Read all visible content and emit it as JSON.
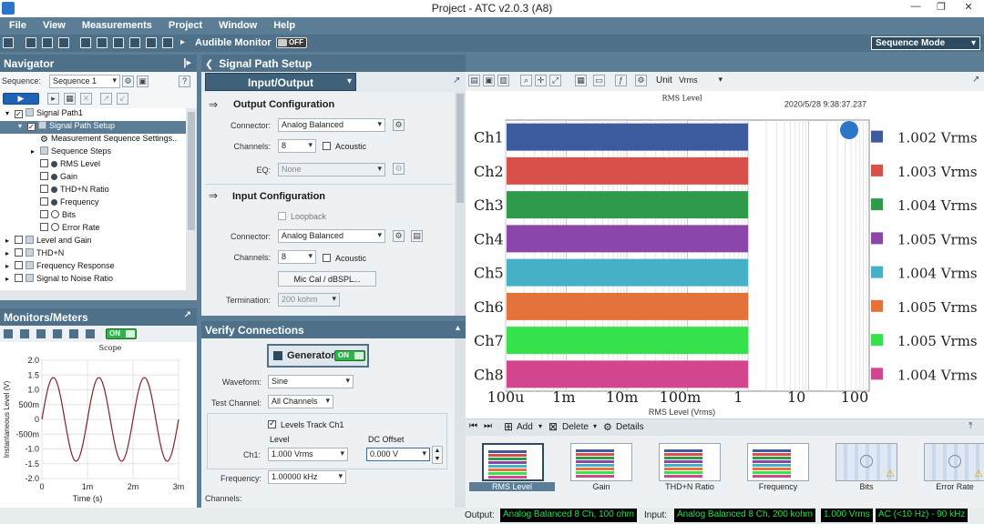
{
  "window": {
    "title": "Project - ATC v2.0.3 (A8)",
    "minimize": "—",
    "restore": "❐",
    "close": "✕"
  },
  "menu": [
    "File",
    "View",
    "Measurements",
    "Project",
    "Window",
    "Help"
  ],
  "toolbar": {
    "audible_monitor_label": "Audible Monitor",
    "audible_monitor_state": "OFF",
    "mode_select": "Sequence Mode"
  },
  "navigator": {
    "title": "Navigator",
    "sequence_label": "Sequence:",
    "sequence_value": "Sequence 1",
    "tree": [
      {
        "label": "Signal Path1",
        "level": 0,
        "icon": "folder-icon",
        "checked": true,
        "expander": "▾"
      },
      {
        "label": "Signal Path Setup",
        "level": 1,
        "icon": "folder-icon",
        "checked": true,
        "expander": "▾",
        "selected": true
      },
      {
        "label": "Measurement Sequence Settings..",
        "level": 2,
        "icon": "gear-icon",
        "checked": null,
        "expander": ""
      },
      {
        "label": "Sequence Steps",
        "level": 2,
        "icon": "folder-icon",
        "checked": null,
        "expander": "▸"
      },
      {
        "label": "RMS Level",
        "level": 2,
        "icon": "dot-icon",
        "checked": false,
        "expander": ""
      },
      {
        "label": "Gain",
        "level": 2,
        "icon": "dot-icon",
        "checked": false,
        "expander": ""
      },
      {
        "label": "THD+N Ratio",
        "level": 2,
        "icon": "dot-icon",
        "checked": false,
        "expander": ""
      },
      {
        "label": "Frequency",
        "level": 2,
        "icon": "dot-icon",
        "checked": false,
        "expander": ""
      },
      {
        "label": "Bits",
        "level": 2,
        "icon": "no-icon",
        "checked": false,
        "expander": ""
      },
      {
        "label": "Error Rate",
        "level": 2,
        "icon": "no-icon",
        "checked": false,
        "expander": ""
      },
      {
        "label": "Level and Gain",
        "level": 0,
        "icon": "folder-icon",
        "checked": false,
        "expander": "▸"
      },
      {
        "label": "THD+N",
        "level": 0,
        "icon": "folder-icon",
        "checked": false,
        "expander": "▸"
      },
      {
        "label": "Frequency Response",
        "level": 0,
        "icon": "folder-icon",
        "checked": false,
        "expander": "▸"
      },
      {
        "label": "Signal to Noise Ratio",
        "level": 0,
        "icon": "folder-icon",
        "checked": false,
        "expander": "▸"
      }
    ]
  },
  "monitors": {
    "title": "Monitors/Meters",
    "toggle_state": "ON",
    "scope": {
      "title": "Scope",
      "ylabel": "Instantaneous Level (V)",
      "xlabel": "Time (s)",
      "yticks": [
        "2.0",
        "1.5",
        "1.0",
        "500m",
        "0",
        "-500m",
        "-1.0",
        "-1.5",
        "-2.0"
      ],
      "xticks": [
        "0",
        "1m",
        "2m",
        "3m"
      ]
    }
  },
  "signal_path_setup": {
    "title": "Signal Path Setup",
    "io_panel_title": "Input/Output",
    "output_config": {
      "title": "Output Configuration",
      "connector_label": "Connector:",
      "connector_value": "Analog Balanced",
      "channels_label": "Channels:",
      "channels_value": "8",
      "acoustic_label": "Acoustic",
      "eq_label": "EQ:",
      "eq_value": "None"
    },
    "input_config": {
      "title": "Input Configuration",
      "loopback_label": "Loopback",
      "connector_label": "Connector:",
      "connector_value": "Analog Balanced",
      "channels_label": "Channels:",
      "channels_value": "8",
      "acoustic_label": "Acoustic",
      "mic_cal_button": "Mic Cal / dBSPL...",
      "termination_label": "Termination:",
      "termination_value": "200 kohm"
    }
  },
  "verify": {
    "title": "Verify Connections",
    "generator_label": "Generator",
    "generator_state": "ON",
    "waveform_label": "Waveform:",
    "waveform_value": "Sine",
    "test_channel_label": "Test Channel:",
    "test_channel_value": "All Channels",
    "levels_track_label": "Levels Track Ch1",
    "level_header": "Level",
    "dc_offset_header": "DC Offset",
    "ch1_label": "Ch1:",
    "ch1_level": "1.000 Vrms",
    "ch1_dc": "0.000 V",
    "frequency_label": "Frequency:",
    "frequency_value": "1.00000 kHz",
    "channels_label": "Channels:"
  },
  "graph": {
    "unit_label": "Unit",
    "unit_value": "Vrms",
    "timestamp": "2020/5/28 9:38:37.237"
  },
  "colors": {
    "Ch1": "#3d5a9c",
    "Ch2": "#d9504a",
    "Ch3": "#2f9a4c",
    "Ch4": "#8a46a8",
    "Ch5": "#46b0c6",
    "Ch6": "#e3733b",
    "Ch7": "#35e24c",
    "Ch8": "#d4458f"
  },
  "chart_data": [
    {
      "type": "bar",
      "orientation": "horizontal",
      "title": "RMS Level",
      "xlabel": "RMS Level (Vrms)",
      "xscale": "log",
      "xlim": [
        0.0001,
        100
      ],
      "xticks": [
        "100u",
        "1m",
        "10m",
        "100m",
        "1",
        "10",
        "100"
      ],
      "grid": true,
      "legend": "right",
      "categories": [
        "Ch1",
        "Ch2",
        "Ch3",
        "Ch4",
        "Ch5",
        "Ch6",
        "Ch7",
        "Ch8"
      ],
      "values": [
        1.002,
        1.003,
        1.004,
        1.005,
        1.004,
        1.005,
        1.005,
        1.004
      ],
      "value_labels": [
        "1.002 Vrms",
        "1.003 Vrms",
        "1.004 Vrms",
        "1.005 Vrms",
        "1.004 Vrms",
        "1.005 Vrms",
        "1.005 Vrms",
        "1.004 Vrms"
      ]
    },
    {
      "type": "line",
      "title": "Scope",
      "xlabel": "Time (s)",
      "ylabel": "Instantaneous Level (V)",
      "xlim": [
        0,
        0.003
      ],
      "ylim": [
        -2.0,
        2.0
      ],
      "series": [
        {
          "amplitude_v": 1.414,
          "frequency_hz": 1000
        }
      ]
    }
  ],
  "steps": {
    "add_label": "Add",
    "delete_label": "Delete",
    "details_label": "Details",
    "items": [
      {
        "label": "RMS Level",
        "selected": true,
        "warning": false
      },
      {
        "label": "Gain",
        "selected": false,
        "warning": false
      },
      {
        "label": "THD+N Ratio",
        "selected": false,
        "warning": false
      },
      {
        "label": "Frequency",
        "selected": false,
        "warning": false
      },
      {
        "label": "Bits",
        "selected": false,
        "warning": true
      },
      {
        "label": "Error Rate",
        "selected": false,
        "warning": true
      }
    ]
  },
  "status": {
    "output_label": "Output:",
    "output_value": "Analog Balanced 8 Ch, 100 ohm",
    "input_label": "Input:",
    "input_value": "Analog Balanced 8 Ch, 200 kohm",
    "level_value": "1.000 Vrms",
    "filter_value": "AC (<10 Hz) - 90 kHz"
  }
}
